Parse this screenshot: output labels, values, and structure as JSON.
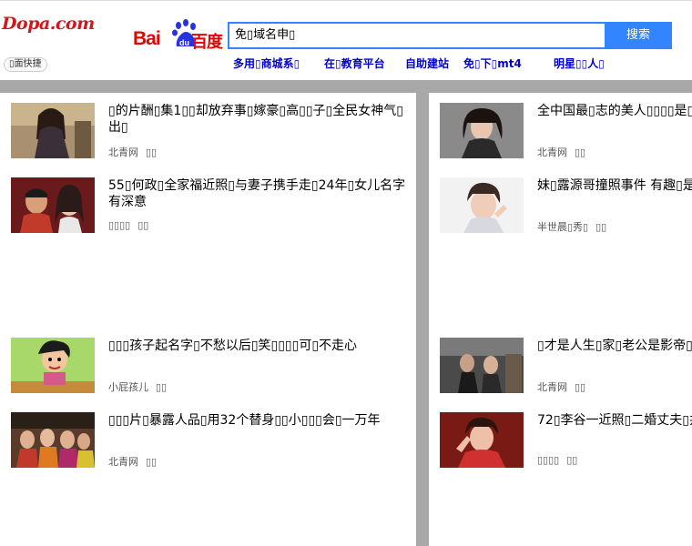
{
  "header": {
    "site_logo": "Dopa.com",
    "baidu_logo_latin": "Bai",
    "baidu_logo_cn": "百度",
    "search_value": "免▯域名申▯",
    "search_button": "搜索",
    "quick_button": "▯面快捷",
    "hot_links": [
      {
        "label": "多用▯商城系▯"
      },
      {
        "label": "在▯教育平台"
      },
      {
        "label": "自助建站"
      },
      {
        "label": "免▯下▯mt4"
      },
      {
        "label": "明星▯▯人▯"
      }
    ]
  },
  "left_items": [
    {
      "title": "▯的片酬▯集1▯▯却放弃事▯嫁豪▯高▯▯子▯全民女神气▯出▯",
      "source": "北青网",
      "tag": "▯▯"
    },
    {
      "title": "55▯何政▯全家福近照▯与妻子携手走▯24年▯女儿名字有深意",
      "source": "▯▯▯▯",
      "tag": "▯▯"
    },
    {
      "title": "▯▯▯孩子起名字▯不愁以后▯笑▯▯▯▯可▯不走心",
      "source": "小屁孩儿",
      "tag": "▯▯"
    },
    {
      "title": "▯▯▯片▯暴露人品▯用32个替身▯▯小▯▯▯会▯一万年",
      "source": "北青网",
      "tag": "▯▯"
    }
  ],
  "right_items": [
    {
      "title": "全中国最▯志的美人▯▯▯▯是▯",
      "source": "北青网",
      "tag": "▯▯"
    },
    {
      "title": "妹▯露源哥撞照事件 有趣▯是▯",
      "source": "半世晨▯秀▯",
      "tag": "▯▯"
    },
    {
      "title": "▯才是人生▯家▯老公是影帝▯",
      "source": "北青网",
      "tag": "▯▯"
    },
    {
      "title": "72▯李谷一近照▯二婚丈夫▯井",
      "source": "▯▯▯▯",
      "tag": "▯▯"
    }
  ]
}
